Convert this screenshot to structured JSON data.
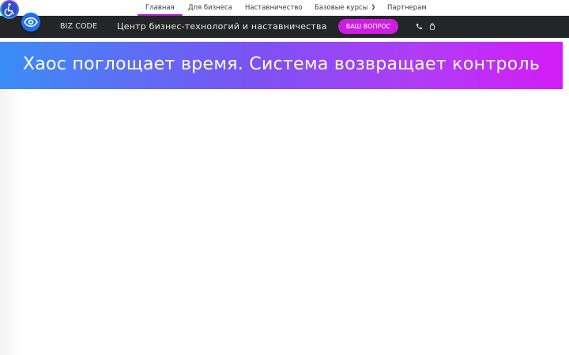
{
  "topnav": {
    "items": [
      {
        "label": "Главная"
      },
      {
        "label": "Для бизнеса"
      },
      {
        "label": "Наставничество"
      },
      {
        "label": "Базовые курсы"
      },
      {
        "label": "Партнерам"
      }
    ]
  },
  "header": {
    "brand": "BIZ CODE",
    "tagline": "Центр бизнес-технологий и наставничества",
    "ask_button": "ВАШ ВОПРОС"
  },
  "hero": {
    "title": "Хаос поглощает время. Система возвращает контроль"
  },
  "colors": {
    "accent": "#cc1ee0",
    "dark_bar": "#232527",
    "gradient_start": "#3b8df5",
    "gradient_end": "#d31cf7"
  },
  "icons": [
    "accessibility-icon",
    "eye-icon",
    "phone-icon",
    "bag-icon",
    "chevron-down-icon"
  ]
}
